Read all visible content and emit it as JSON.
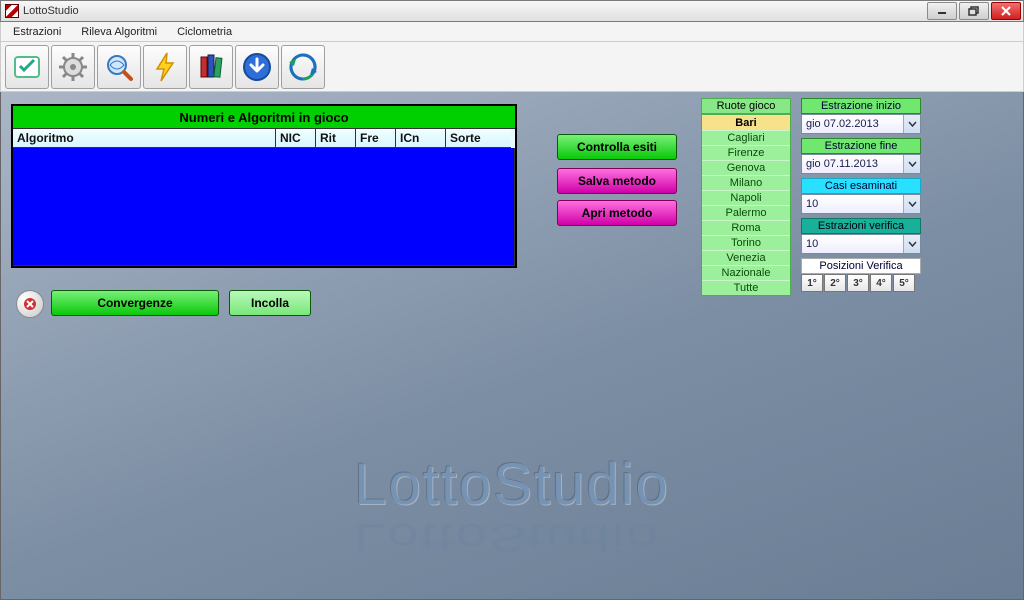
{
  "window": {
    "title": "LottoStudio",
    "min": "–",
    "max": "❐",
    "close": "×"
  },
  "menu": {
    "items": [
      "Estrazioni",
      "Rileva Algoritmi",
      "Ciclometria"
    ]
  },
  "panel": {
    "title": "Numeri e Algoritmi in gioco",
    "cols": {
      "alg": "Algoritmo",
      "nic": "NIC",
      "rit": "Rit",
      "fre": "Fre",
      "icn": "ICn",
      "sorte": "Sorte"
    }
  },
  "buttons": {
    "convergenze": "Convergenze",
    "incolla": "Incolla",
    "controlla": "Controlla esiti",
    "salva": "Salva metodo",
    "apri": "Apri metodo"
  },
  "ruote": {
    "header": "Ruote gioco",
    "items": [
      "Bari",
      "Cagliari",
      "Firenze",
      "Genova",
      "Milano",
      "Napoli",
      "Palermo",
      "Roma",
      "Torino",
      "Venezia",
      "Nazionale",
      "Tutte"
    ],
    "selected": "Bari"
  },
  "right": {
    "estrazione_inizio": {
      "label": "Estrazione inizio",
      "value": "gio 07.02.2013"
    },
    "estrazione_fine": {
      "label": "Estrazione fine",
      "value": "gio 07.11.2013"
    },
    "casi": {
      "label": "Casi esaminati",
      "value": "10"
    },
    "verifica": {
      "label": "Estrazioni verifica",
      "value": "10"
    },
    "posizioni": {
      "label": "Posizioni Verifica",
      "items": [
        "1°",
        "2°",
        "3°",
        "4°",
        "5°"
      ]
    }
  },
  "watermark": "LottoStudio"
}
